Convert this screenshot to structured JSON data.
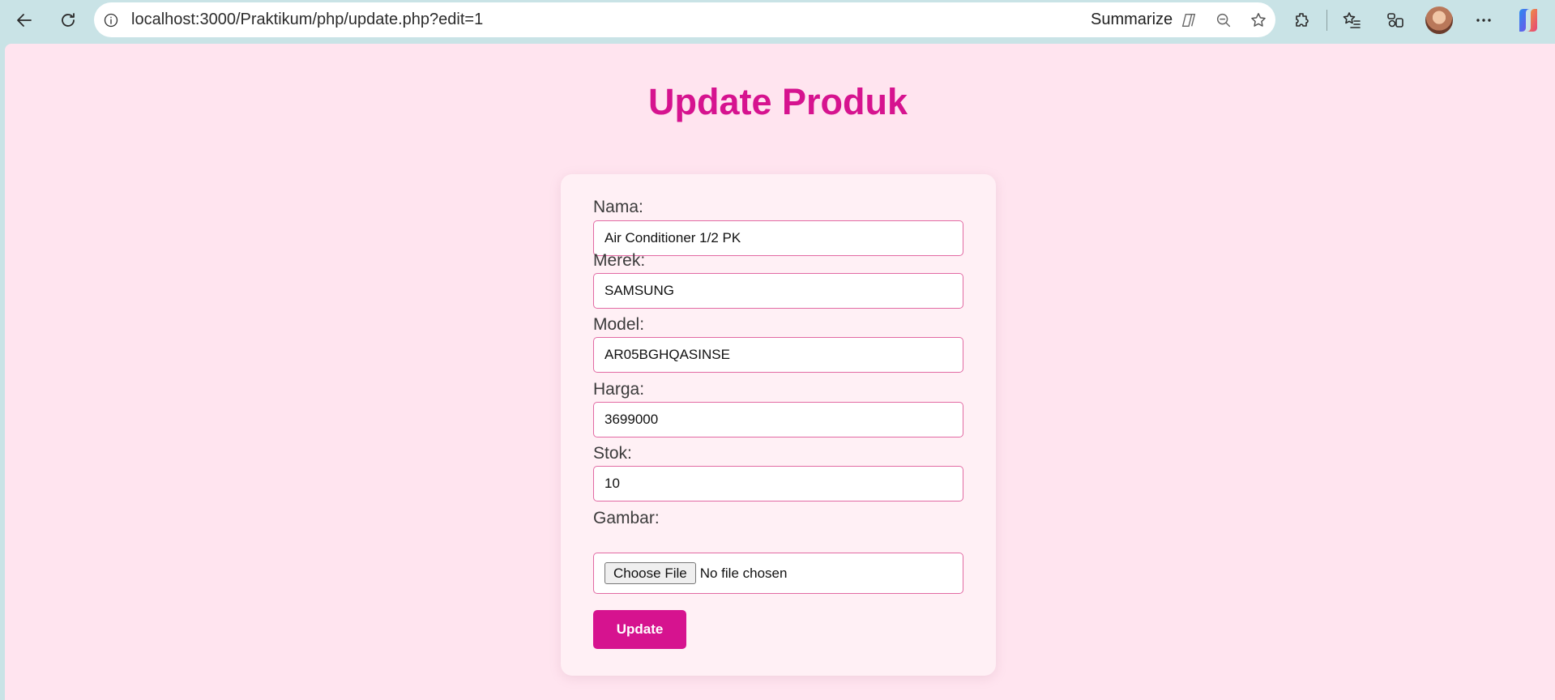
{
  "browser": {
    "url": "localhost:3000/Praktikum/php/update.php?edit=1",
    "summarize_label": "Summarize"
  },
  "page": {
    "title": "Update Produk"
  },
  "form": {
    "fields": [
      {
        "label": "Nama:",
        "value": "Air Conditioner 1/2 PK"
      },
      {
        "label": "Merek:",
        "value": "SAMSUNG"
      },
      {
        "label": "Model:",
        "value": "AR05BGHQASINSE"
      },
      {
        "label": "Harga:",
        "value": "3699000"
      },
      {
        "label": "Stok:",
        "value": "10"
      }
    ],
    "image": {
      "label": "Gambar:",
      "button_label": "Choose File",
      "status": "No file chosen"
    },
    "submit_label": "Update"
  },
  "colors": {
    "accent": "#d6138f",
    "page_background": "#ffe4ef",
    "card_background": "#fff0f5",
    "input_border": "#e26aa3"
  }
}
